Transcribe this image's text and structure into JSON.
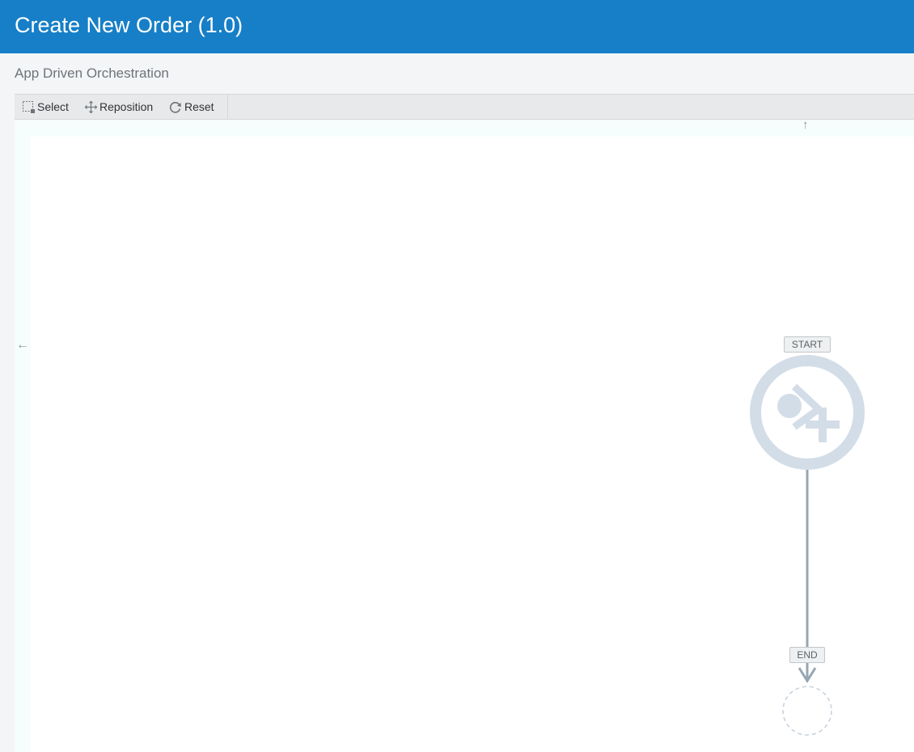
{
  "header": {
    "title": "Create New Order (1.0)"
  },
  "subtitle": "App Driven Orchestration",
  "toolbar": {
    "select_label": "Select",
    "reposition_label": "Reposition",
    "reset_label": "Reset"
  },
  "canvas": {
    "scroll_up_glyph": "↑",
    "scroll_left_glyph": "←",
    "start_label": "START",
    "end_label": "END"
  },
  "icons": {
    "select": "marquee-select-icon",
    "reposition": "move-arrows-icon",
    "reset": "refresh-icon",
    "start_node": "trigger-add-icon"
  },
  "colors": {
    "header_bg": "#167fc7",
    "node_ring": "#d3dde7",
    "connector": "#97a6b3"
  }
}
